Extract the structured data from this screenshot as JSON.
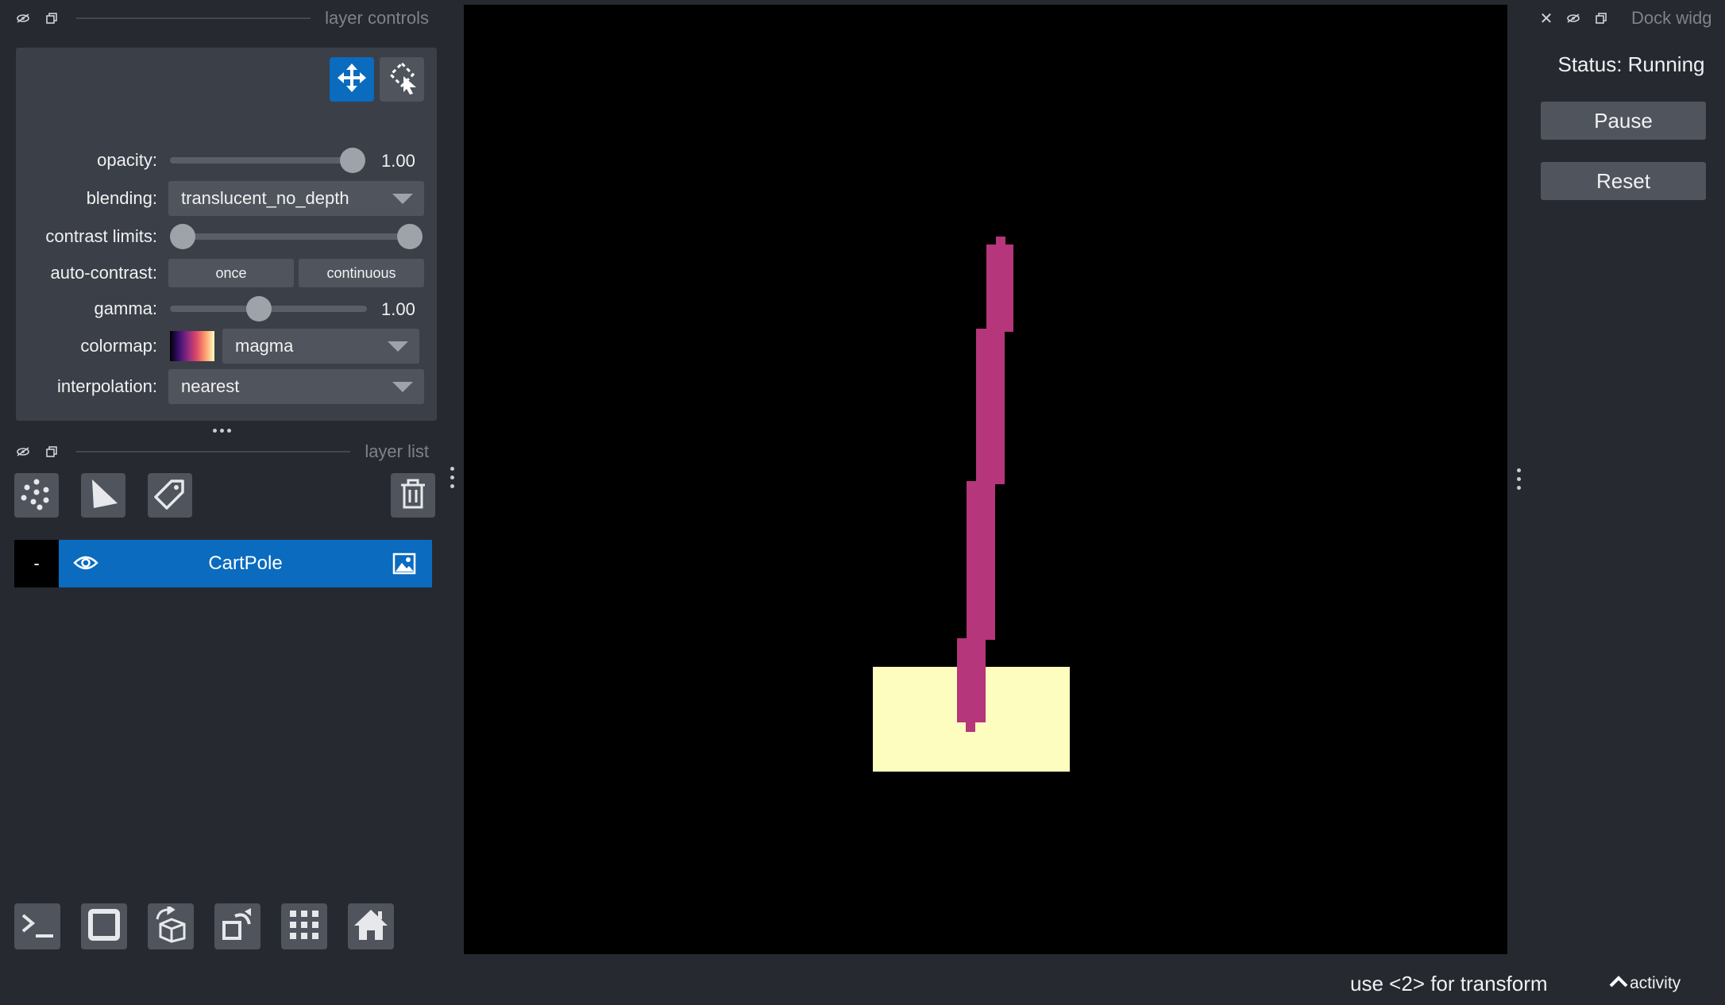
{
  "layer_controls": {
    "title": "layer controls",
    "opacity": {
      "label": "opacity:",
      "value": "1.00",
      "level": 1.0
    },
    "blending": {
      "label": "blending:",
      "value": "translucent_no_depth"
    },
    "contrast_limits": {
      "label": "contrast limits:",
      "low": 0.0,
      "high": 1.0
    },
    "auto_contrast": {
      "label": "auto-contrast:",
      "once_label": "once",
      "continuous_label": "continuous"
    },
    "gamma": {
      "label": "gamma:",
      "value": "1.00",
      "level": 0.45
    },
    "colormap": {
      "label": "colormap:",
      "value": "magma"
    },
    "interpolation": {
      "label": "interpolation:",
      "value": "nearest"
    }
  },
  "layer_list": {
    "title": "layer list",
    "layers": [
      {
        "name": "CartPole",
        "thumb_text": "-",
        "visible": true,
        "type_icon": "image-icon"
      }
    ]
  },
  "dock_widget": {
    "title": "Dock widg",
    "status": "Status: Running",
    "pause_label": "Pause",
    "reset_label": "Reset"
  },
  "status_bar": {
    "hint": "use <2> for transform",
    "activity_label": "activity"
  },
  "colors": {
    "accent": "#0a6bbf",
    "background": "#262930",
    "panel": "#3b3f47",
    "button": "#50545c",
    "pole": "#b5367a",
    "cart": "#fcfdbf"
  }
}
